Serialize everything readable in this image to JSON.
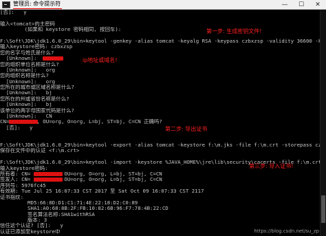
{
  "window": {
    "title": "管理员: 命令提示符",
    "minimize": "—",
    "maximize": "☐",
    "close": "✕"
  },
  "colors": {
    "annotation": "#ff2020",
    "redaction": "#dd1111",
    "console_bg": "#000000"
  },
  "console_lines": [
    "[否]:   y",
    "",
    "输入<tomcat>的主密码",
    "        (如果和 keystore 密码相同, 按回车):",
    "",
    "F:\\Soft\\JDK\\jdk1.6.0_29\\bin>keytool -genkey -alias tomcat -keyalg RSA -keypass czbxzsp -validity 36600 -keystore f:\\m.jks",
    "输入keystore密码: czbxzsp",
    "您的名字与姓氏是什么?",
    "  [Unknown]: ",
    "您的组织单位名称是什么?",
    "  [Unknown]:   org",
    "您的组织名称是什么?",
    "  [Unknown]:   org",
    "您所在的城市或区域名称是什么?",
    "  [Unknown]:   bj",
    "您所在的州或省份名称是什么?",
    "  [Unknown]:   bj",
    "该单位的两字母国家代码是什么?",
    "  [Unknown]:   CN",
    "CN=         , OU=org, O=org, L=bj, ST=bj, C=CN 正确吗?",
    "  [否]:   y",
    "",
    "",
    "F:\\Soft\\JDK\\jdk1.6.0_29\\bin>keytool -export -alias tomcat -keystore f:\\m.jks -file f:\\m.crt -storepass czbxzsp",
    "保存在文件中的认证 <f:\\m.crt>",
    "",
    "F:\\Soft\\JDK\\jdk1.6.0_29\\bin>keytool -import -keystore %JAVA_HOME%\\jre\\lib\\security\\cacerts -file f:\\m.crt -alias tomcat",
    "输入keystore密码:",
    "所有者: CN=         , OU=org, O=org, L=bj, ST=bj, C=CN",
    "签发人: CN=         , OU=org, O=org, L=bj, ST=bj, C=CN",
    "序列号: 5976fc45",
    "有效期: Tue Jul 25 16:07:33 CST 2017 至 Sat Oct 09 16:07:33 CST 2117",
    "证书指纹:",
    "         MD5:66:8D:D1:C1:71:4E:22:18:D2:C0:89",
    "         SHA1:A0:68:8B:2F:FB:10:82:6B:96:F7:78:4B:22:CD",
    "         签名算法名称:SHA1withRSA",
    "         版本: 3",
    "信任这个认证? [否]:   y",
    "认证已添加至keystore中",
    ""
  ],
  "annotations": [
    {
      "text": "第一步: 生成密钥文件!"
    },
    {
      "text": "ip地址或域名!"
    },
    {
      "text": "第二步: 导出证书"
    },
    {
      "text": "第三步: 导入证书!"
    }
  ],
  "watermark": "https://blog.csdn.net/su_zp"
}
